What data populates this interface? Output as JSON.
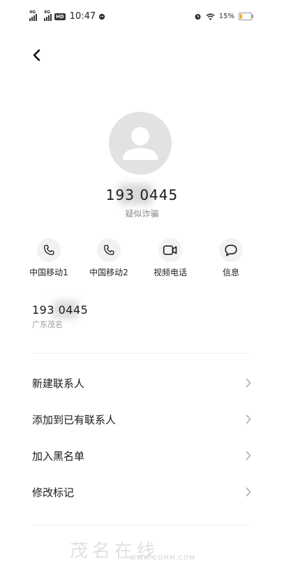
{
  "status_bar": {
    "sim1_net": "4G",
    "sim2_net": "4G",
    "hd_badge": "HD",
    "time": "10:47",
    "battery_percent": "15%",
    "icons": [
      "signal-icon",
      "signal-icon",
      "hd-icon",
      "chat-bubble-icon",
      "alarm-icon",
      "wifi-icon",
      "battery-icon"
    ],
    "battery_color": "#f5a623"
  },
  "header": {
    "back_icon": "chevron-left-icon"
  },
  "contact": {
    "avatar_icon": "person-icon",
    "number_masked": "193 0445",
    "tag": "疑似诈骗"
  },
  "actions": [
    {
      "label": "中国移动1",
      "icon": "phone-icon"
    },
    {
      "label": "中国移动2",
      "icon": "phone-icon"
    },
    {
      "label": "视频电话",
      "icon": "video-icon"
    },
    {
      "label": "信息",
      "icon": "message-icon"
    }
  ],
  "detail": {
    "number_masked": "193 0445",
    "location": "广东茂名"
  },
  "menu": [
    {
      "label": "新建联系人"
    },
    {
      "label": "添加到已有联系人"
    },
    {
      "label": "加入黑名单"
    },
    {
      "label": "修改标记"
    }
  ],
  "watermark": {
    "text": "茂名在线",
    "url": "WWW.GDMM.COM"
  },
  "colors": {
    "avatar_bg": "#e2e2e2",
    "action_bg": "#f2f2f2",
    "text_primary": "#1a1a1a",
    "text_secondary": "#888888"
  }
}
